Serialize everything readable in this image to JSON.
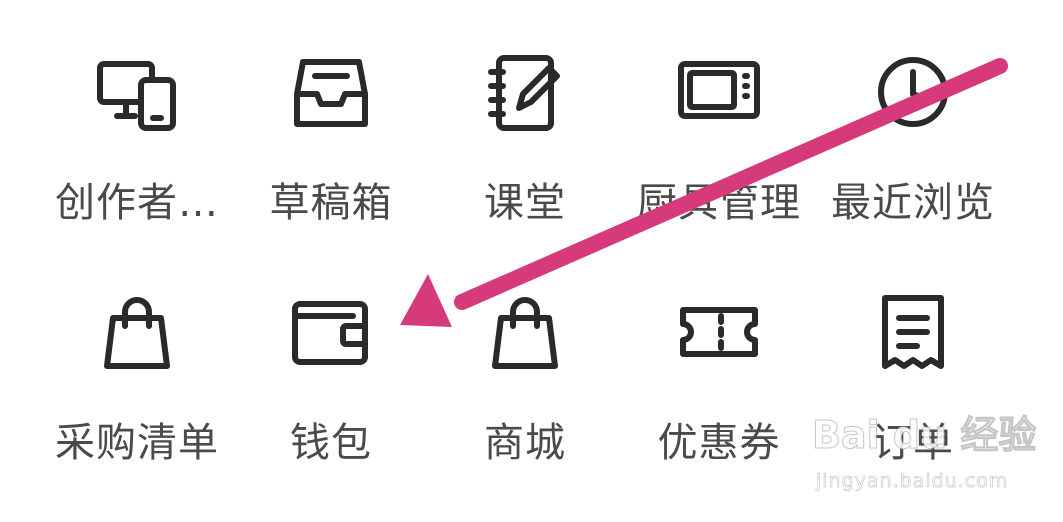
{
  "menu": {
    "row1": [
      {
        "label": "创作者…",
        "icon": "devices-icon"
      },
      {
        "label": "草稿箱",
        "icon": "inbox-tray-icon"
      },
      {
        "label": "课堂",
        "icon": "notebook-pen-icon"
      },
      {
        "label": "厨具管理",
        "icon": "microwave-icon"
      },
      {
        "label": "最近浏览",
        "icon": "clock-icon"
      }
    ],
    "row2": [
      {
        "label": "采购清单",
        "icon": "shopping-bag-icon"
      },
      {
        "label": "钱包",
        "icon": "wallet-icon"
      },
      {
        "label": "商城",
        "icon": "shopping-bag-icon"
      },
      {
        "label": "优惠券",
        "icon": "ticket-icon"
      },
      {
        "label": "订单",
        "icon": "receipt-icon"
      }
    ]
  },
  "watermark": {
    "logo": "Bai du 经验",
    "url": "jingyan.baidu.com"
  },
  "colors": {
    "icon_stroke": "#2a2a2a",
    "label_text": "#4a4a4a",
    "arrow": "#d63a7a",
    "background": "#ffffff"
  }
}
